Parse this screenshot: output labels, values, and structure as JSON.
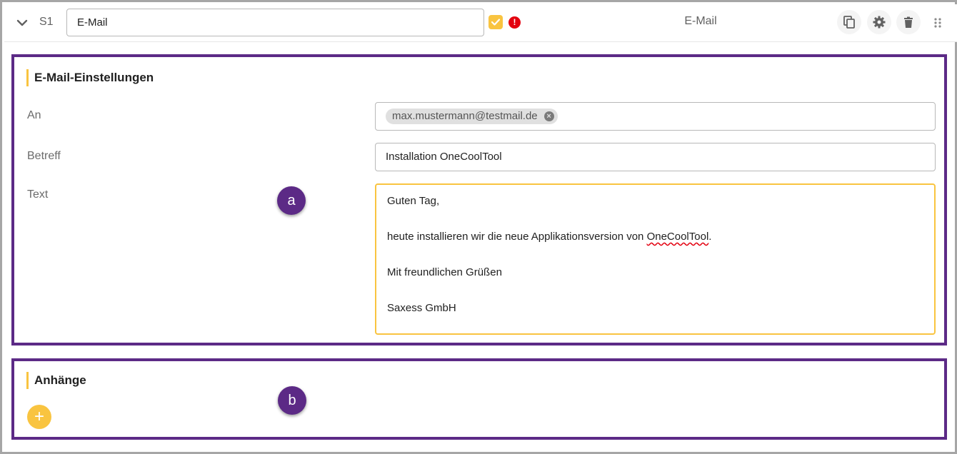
{
  "header": {
    "step": "S1",
    "name_value": "E-Mail",
    "error_mark": "!",
    "title": "E-Mail",
    "icons": [
      "chevron-down-icon",
      "checkbox-checked-icon",
      "error-icon",
      "copy-icon",
      "gear-icon",
      "trash-icon",
      "drag-handle-icon"
    ]
  },
  "email_settings": {
    "title": "E-Mail-Einstellungen",
    "to_label": "An",
    "to_chip": "max.mustermann@testmail.de",
    "to_chip_remove": "×",
    "subject_label": "Betreff",
    "subject_value": "Installation OneCoolTool",
    "text_label": "Text",
    "text_lines": {
      "greeting": "Guten Tag,",
      "body_before": "heute installieren wir die neue Applikationsversion von ",
      "body_misspelled": "OneCoolTool",
      "body_after": ".",
      "closing": "Mit freundlichen Grüßen",
      "signature": "Saxess GmbH"
    },
    "callout": "a"
  },
  "attachments": {
    "title": "Anhänge",
    "add_label": "+",
    "callout": "b"
  },
  "colors": {
    "accent": "#f9c440",
    "frame": "#5c2a86",
    "error": "#e3000f"
  }
}
